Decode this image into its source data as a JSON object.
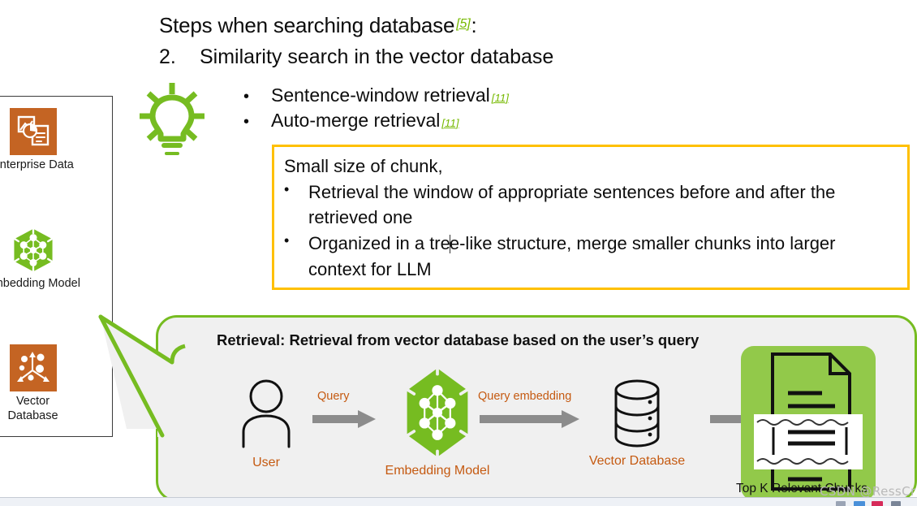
{
  "heading": {
    "title": "Steps when searching database",
    "title_citation": "[5]",
    "title_colon": ":",
    "step_number": "2.",
    "step_text": "Similarity search in the vector database"
  },
  "bullets": [
    {
      "marker": "•",
      "text": "Sentence-window retrieval",
      "citation": "[11]"
    },
    {
      "marker": "•",
      "text": "Auto-merge retrieval",
      "citation": "[11]"
    }
  ],
  "note_box": {
    "border_color": "#FFC000",
    "intro": "Small size of chunk,",
    "items": [
      {
        "marker": "•",
        "text_before_caret": "Retrieval  the window of appropriate sentences before and after the retrieved one",
        "has_caret": false
      },
      {
        "marker": "•",
        "text_before_caret": "Organized in a tre",
        "text_after_caret": "e-like structure, merge smaller chunks into larger context for LLM",
        "has_caret": true
      }
    ]
  },
  "sidebar": {
    "items": [
      {
        "icon": "enterprise-data-icon",
        "label": "Enterprise Data",
        "color": "#C46423"
      },
      {
        "icon": "embedding-model-icon",
        "label": "Embedding Model",
        "color": "#76BC21"
      },
      {
        "icon": "vector-database-icon",
        "label": "Vector\nDatabase",
        "label_line1": "Vector",
        "label_line2": "Database",
        "color": "#C46423"
      }
    ]
  },
  "retrieval": {
    "title": "Retrieval: Retrieval from vector database based on the user’s query",
    "box_border_color": "#76BC21",
    "box_background": "#F0F0F0",
    "nodes": [
      {
        "icon": "user-icon",
        "label": "User"
      },
      {
        "icon": "embedding-model-icon",
        "label": "Embedding Model"
      },
      {
        "icon": "vector-database-icon",
        "label": "Vector Database"
      },
      {
        "icon": "documents-chunks-icon",
        "label": "Top K Relevant Chunks"
      }
    ],
    "arrow_labels": [
      "Query",
      "Query embedding"
    ],
    "label_color": "#C55A11",
    "chunk_panel_color": "#92C94A"
  },
  "bulb": {
    "icon": "lightbulb-icon",
    "color": "#76BC21"
  },
  "watermark": {
    "text": "CSDN @RessCris"
  }
}
